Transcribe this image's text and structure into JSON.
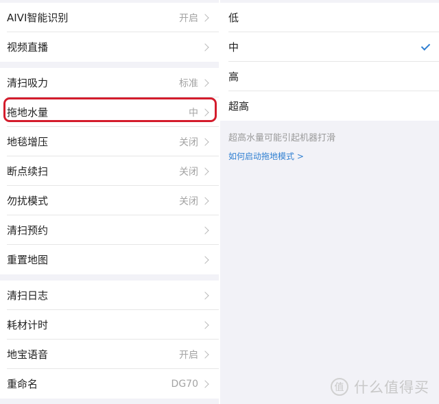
{
  "settings": {
    "group1": [
      {
        "label": "AIVI智能识别",
        "value": "开启"
      },
      {
        "label": "视频直播",
        "value": ""
      }
    ],
    "group2": [
      {
        "label": "清扫吸力",
        "value": "标准"
      },
      {
        "label": "拖地水量",
        "value": "中"
      },
      {
        "label": "地毯增压",
        "value": "关闭"
      },
      {
        "label": "断点续扫",
        "value": "关闭"
      },
      {
        "label": "勿扰模式",
        "value": "关闭"
      },
      {
        "label": "清扫预约",
        "value": ""
      },
      {
        "label": "重置地图",
        "value": ""
      }
    ],
    "group3": [
      {
        "label": "清扫日志",
        "value": ""
      },
      {
        "label": "耗材计时",
        "value": ""
      },
      {
        "label": "地宝语音",
        "value": "开启"
      },
      {
        "label": "重命名",
        "value": "DG70"
      }
    ]
  },
  "water_level": {
    "options": [
      {
        "label": "低"
      },
      {
        "label": "中"
      },
      {
        "label": "高"
      },
      {
        "label": "超高"
      }
    ],
    "selected": "中",
    "hint": "超高水量可能引起机器打滑",
    "link": "如何启动拖地模式 >"
  },
  "accent_color": "#2f7fd1",
  "highlight_color": "#d41c2c",
  "watermark": {
    "icon": "zhi-logo-icon",
    "logo_glyph": "值",
    "text": "什么值得买"
  }
}
